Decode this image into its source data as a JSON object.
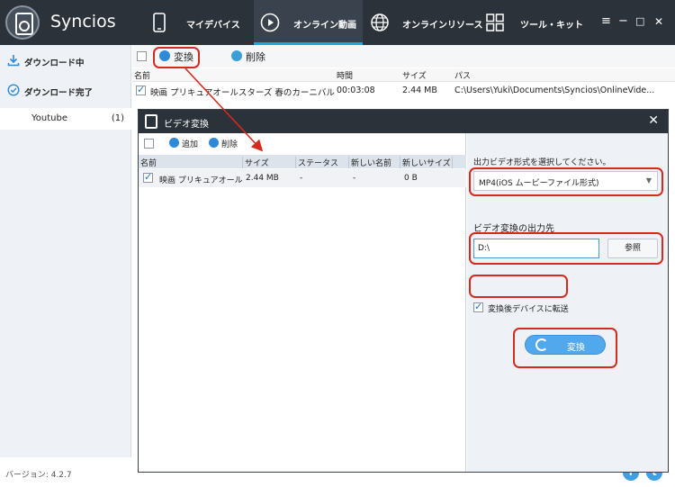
{
  "app": {
    "title": "Syncios"
  },
  "nav": {
    "items": [
      {
        "label": "マイデバイス",
        "icon": "phone-icon"
      },
      {
        "label": "オンライン動画",
        "icon": "play-icon",
        "active": true
      },
      {
        "label": "オンラインリソース",
        "icon": "globe-icon"
      },
      {
        "label": "ツール・キット",
        "icon": "toolkit-icon"
      }
    ]
  },
  "window_controls": {
    "menu": "≡",
    "minimize": "−",
    "maximize": "□",
    "close": "✕"
  },
  "sidebar": {
    "items": [
      {
        "label": "ダウンロード中",
        "icon": "download-icon"
      },
      {
        "label": "ダウンロード完了",
        "icon": "check-circle-icon"
      }
    ],
    "sub_item": {
      "label": "Youtube",
      "count": "(1)"
    }
  },
  "toolbar": {
    "convert_label": "変換",
    "delete_label": "削除"
  },
  "list": {
    "columns": [
      "名前",
      "時間",
      "サイズ",
      "パス"
    ],
    "rows": [
      {
        "name": "映画 プリキュアオールスターズ 春のカーニバル♪本編...",
        "time": "00:03:08",
        "size": "2.44 MB",
        "path": "C:\\Users\\Yuki\\Documents\\Syncios\\OnlineVide..."
      }
    ]
  },
  "status": {
    "version": "バージョン: 4.2.7"
  },
  "social": {
    "facebook": "f",
    "twitter": "t"
  },
  "dialog": {
    "title": "ビデオ変換",
    "close": "✕",
    "add_label": "追加",
    "delete_label": "削除",
    "columns": [
      "名前",
      "サイズ",
      "ステータス",
      "新しい名前",
      "新しいサイズ"
    ],
    "rows": [
      {
        "name": "映画 プリキュアオール...",
        "size": "2.44 MB",
        "status": "-",
        "new_name": "-",
        "new_size": "0 B"
      }
    ],
    "format_label": "出力ビデオ形式を選択してください。",
    "format_value": "MP4(iOS ムービーファイル形式)",
    "output_label": "ビデオ変換の出力先",
    "output_value": "D:\\",
    "browse_label": "参照",
    "transfer_label": "変換後デバイスに転送",
    "transfer_checked": true,
    "convert_label": "変換"
  },
  "colors": {
    "header": "#2b323a",
    "accent": "#1ea6e0",
    "highlight": "#d42b1e",
    "button": "#52a8ec"
  }
}
